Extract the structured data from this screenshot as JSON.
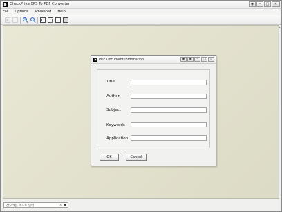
{
  "window": {
    "title": "CheckPrixa XPS To PDF Converter",
    "controls": {
      "minimize": "–",
      "maximize": "□",
      "close": "✕",
      "extra": "◉"
    }
  },
  "menu": {
    "items": [
      {
        "label": "File"
      },
      {
        "label": "Options"
      },
      {
        "label": "Advanced"
      },
      {
        "label": "Help"
      }
    ]
  },
  "toolbar": {
    "zoom_in_sign": "+",
    "zoom_out_sign": "−"
  },
  "dialog": {
    "title": "PDF Document Information",
    "controls": {
      "extra": "◉",
      "restore": "▣",
      "minimize": "–",
      "maximize": "□",
      "close": "✕"
    },
    "fields": [
      {
        "label": "Title",
        "value": ""
      },
      {
        "label": "Author",
        "value": ""
      },
      {
        "label": "Subject",
        "value": ""
      },
      {
        "label": "Keywords",
        "value": ""
      },
      {
        "label": "Application",
        "value": ""
      }
    ],
    "ok_label": "OK",
    "cancel_label": "Cancel"
  },
  "statusbar": {
    "search_placeholder": "찾으려는 텍스트 입력",
    "clear_glyph": "x"
  }
}
